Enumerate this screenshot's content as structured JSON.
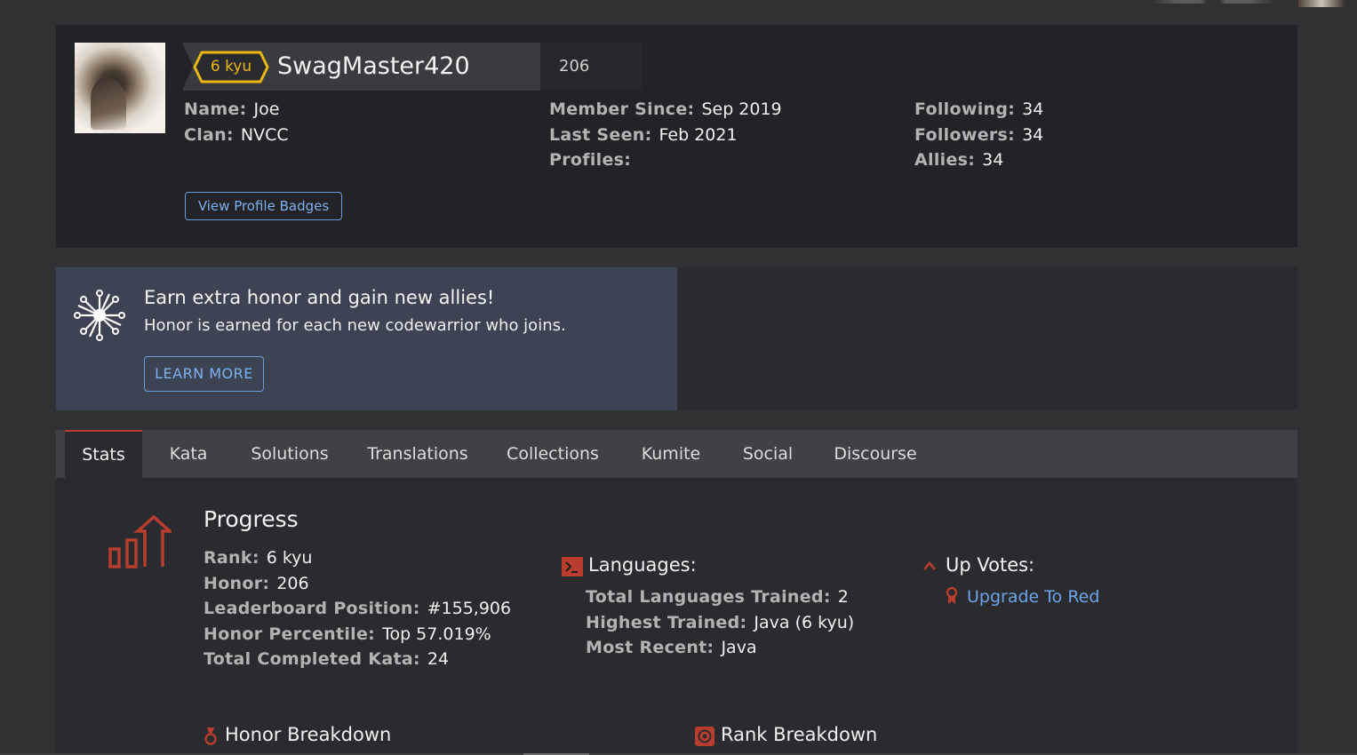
{
  "profile": {
    "rank_badge": "6 kyu",
    "username": "SwagMaster420",
    "honor": "206",
    "col1": [
      {
        "label": "Name:",
        "value": "Joe"
      },
      {
        "label": "Clan:",
        "value": "NVCC"
      }
    ],
    "col2": [
      {
        "label": "Member Since:",
        "value": "Sep 2019"
      },
      {
        "label": "Last Seen:",
        "value": "Feb 2021"
      },
      {
        "label": "Profiles:",
        "value": ""
      }
    ],
    "col3": [
      {
        "label": "Following:",
        "value": "34"
      },
      {
        "label": "Followers:",
        "value": "34"
      },
      {
        "label": "Allies:",
        "value": "34"
      }
    ],
    "badges_button": "View Profile Badges"
  },
  "promo": {
    "title": "Earn extra honor and gain new allies!",
    "subtitle": "Honor is earned for each new codewarrior who joins.",
    "button": "LEARN MORE"
  },
  "tabs": [
    "Stats",
    "Kata",
    "Solutions",
    "Translations",
    "Collections",
    "Kumite",
    "Social",
    "Discourse"
  ],
  "stats": {
    "progress_title": "Progress",
    "progress": [
      {
        "label": "Rank:",
        "value": "6 kyu"
      },
      {
        "label": "Honor:",
        "value": "206"
      },
      {
        "label": "Leaderboard Position:",
        "value": "#155,906"
      },
      {
        "label": "Honor Percentile:",
        "value": "Top 57.019%"
      },
      {
        "label": "Total Completed Kata:",
        "value": "24"
      }
    ],
    "languages_title": "Languages:",
    "languages": [
      {
        "label": "Total Languages Trained:",
        "value": "2"
      },
      {
        "label": "Highest Trained:",
        "value": "Java (6 kyu)"
      },
      {
        "label": "Most Recent:",
        "value": "Java"
      }
    ],
    "upvotes_title": "Up Votes:",
    "upgrade_link": "Upgrade To Red",
    "honor_breakdown": "Honor Breakdown",
    "rank_breakdown": "Rank Breakdown"
  },
  "colors": {
    "rank_yellow": "#ecb613",
    "accent_red": "#b83d2f",
    "link_blue": "#6fa3e8",
    "panel": "#222326",
    "promo": "#3c4352"
  },
  "icons": [
    "progress-chart-icon",
    "terminal-icon",
    "chevron-up-icon",
    "award-ribbon-icon",
    "medal-icon",
    "target-icon",
    "network-burst-icon"
  ]
}
